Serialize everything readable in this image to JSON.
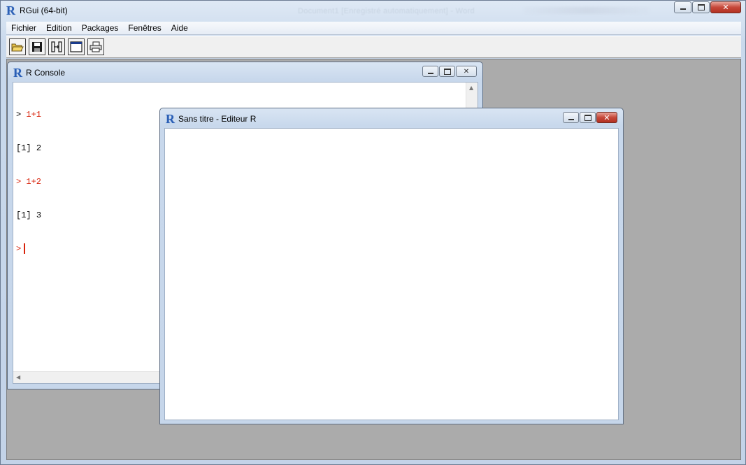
{
  "app": {
    "title": "RGui (64-bit)",
    "background_title": "Document1 [Enregistré automatiquement] - Word"
  },
  "menu": [
    "Fichier",
    "Edition",
    "Packages",
    "Fenêtres",
    "Aide"
  ],
  "toolbar": [
    {
      "name": "open-script-icon"
    },
    {
      "name": "save-icon"
    },
    {
      "name": "copy-paste-icon"
    },
    {
      "name": "console-icon"
    },
    {
      "name": "print-icon"
    }
  ],
  "console": {
    "title": "R Console",
    "lines": [
      {
        "prompt": ">",
        "text": "1+1",
        "kind": "input"
      },
      {
        "prompt": "[1]",
        "text": "2",
        "kind": "output"
      },
      {
        "prompt": ">",
        "text": "1+2",
        "kind": "input"
      },
      {
        "prompt": "[1]",
        "text": "3",
        "kind": "output"
      },
      {
        "prompt": ">",
        "text": "",
        "kind": "current"
      }
    ]
  },
  "editor": {
    "title": "Sans titre - Editeur R"
  },
  "colors": {
    "input": "#d8230b",
    "accent": "#2b5fb5",
    "mdi_background": "#ababab"
  }
}
